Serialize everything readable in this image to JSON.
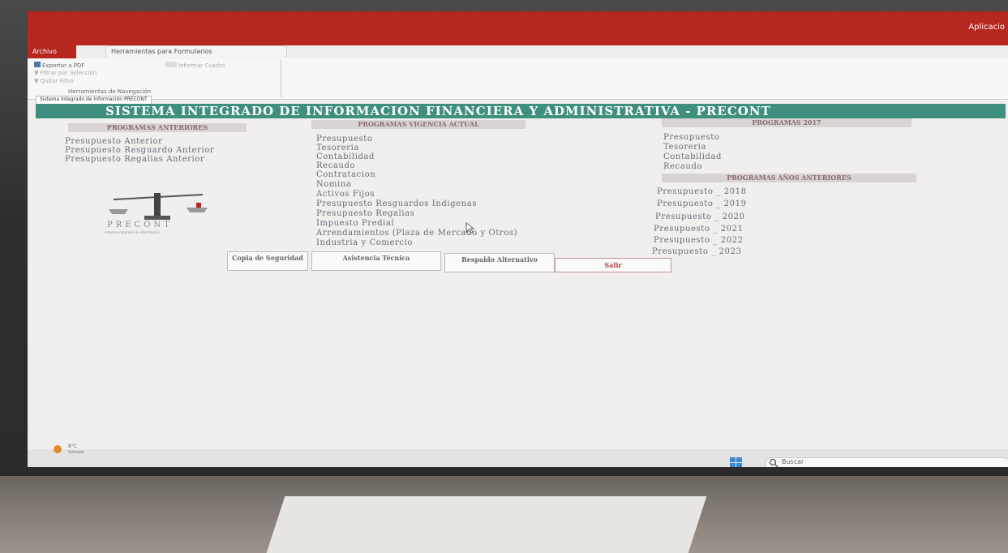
{
  "app": {
    "title": "Aplicacio",
    "tabs": [
      "Archivo",
      "Herramientas para Formularios"
    ],
    "ribbon": {
      "export_pdf": "Exportar a PDF",
      "btn2": "Informar Cuadro",
      "filter1": "Filtrar por Selección",
      "filter2": "Quitar Filtro",
      "group_label": "Herramientas de Navegación"
    },
    "document_tab": "Sistema Integrado de Información PRECONT"
  },
  "header": {
    "title": "SISTEMA INTEGRADO DE INFORMACION FINANCIERA Y ADMINISTRATIVA - PRECONT"
  },
  "columns": {
    "anteriores": {
      "title": "PROGRAMAS ANTERIORES",
      "items": [
        "Presupuesto Anterior",
        "Presupuesto Resguardo Anterior",
        "Presupuesto Regalias Anterior"
      ]
    },
    "vigencia": {
      "title": "PROGRAMAS VIGENCIA ACTUAL",
      "items": [
        "Presupuesto",
        "Tesoreria",
        "Contabilidad",
        "Recaudo",
        "Contratacion",
        "Nomina",
        "Activos Fijos",
        "Presupuesto Resguardos Indigenas",
        "Presupuesto Regalias",
        "Impuesto Predial",
        "Arrendamientos (Plaza de Mercado y Otros)",
        "Industria y Comercio"
      ]
    },
    "p2017": {
      "title": "PROGRAMAS 2017",
      "items": [
        "Presupuesto",
        "Tesoreria",
        "Contabilidad",
        "Recaudo"
      ]
    },
    "anios": {
      "title": "PROGRAMAS AÑOS ANTERIORES",
      "items": [
        "Presupuesto _ 2018",
        "Presupuesto _ 2019",
        "Presupuesto _ 2020",
        "Presupuesto _ 2021",
        "Presupuesto _ 2022",
        "Presupuesto _ 2023"
      ]
    }
  },
  "logo": {
    "text": "PRECONT",
    "subtitle": "sistema integrado de información"
  },
  "buttons": {
    "copia": "Copia de Seguridad",
    "asistencia": "Asistencia Técnica",
    "respaldo": "Respaldo Alternativo",
    "salir": "Salir"
  },
  "taskbar": {
    "weather_temp": "8°C",
    "weather_desc": "Soleado",
    "search": "Buscar"
  },
  "colors": {
    "accent": "#b5271f",
    "header": "#3f8f7f"
  }
}
